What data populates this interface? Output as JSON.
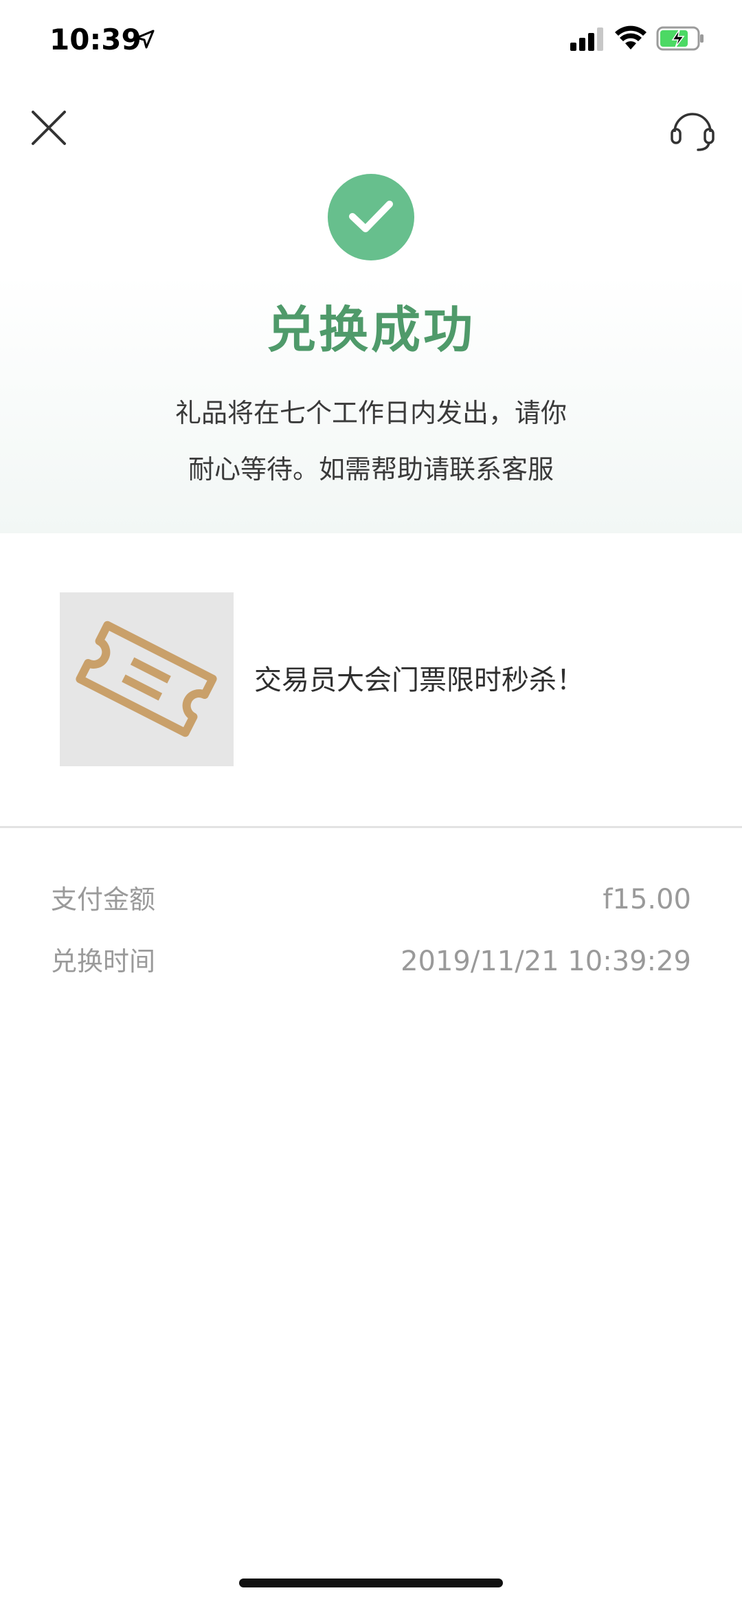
{
  "status_bar": {
    "time": "10:39",
    "icons": [
      "location-arrow-icon",
      "cellular-signal-icon",
      "wifi-icon",
      "battery-charging-icon"
    ],
    "battery_color": "#4cd964"
  },
  "nav": {
    "close_icon": "close-icon",
    "support_icon": "headset-icon"
  },
  "success": {
    "icon": "check-circle-icon",
    "icon_color": "#67bf8d",
    "title": "兑换成功",
    "title_color": "#4f9a6a",
    "message_line1": "礼品将在七个工作日内发出，请你",
    "message_line2": "耐心等待。如需帮助请联系客服"
  },
  "product": {
    "thumbnail_icon": "ticket-icon",
    "thumbnail_icon_color": "#c9a06a",
    "title": "交易员大会门票限时秒杀！"
  },
  "details": {
    "rows": [
      {
        "label": "支付金额",
        "value": "f15.00"
      },
      {
        "label": "兑换时间",
        "value": "2019/11/21 10:39:29"
      }
    ]
  }
}
